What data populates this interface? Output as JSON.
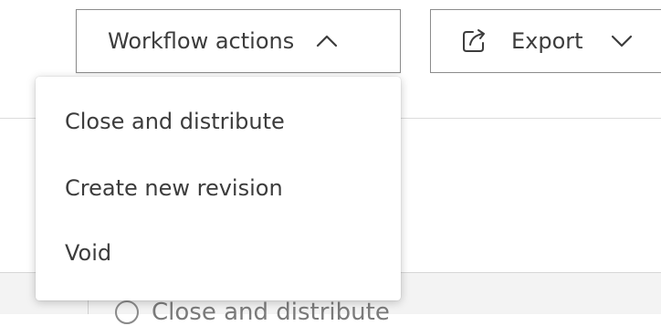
{
  "toolbar": {
    "workflow_label": "Workflow actions",
    "workflow_chevron": "chevron-up-icon",
    "export_label": "Export",
    "export_icon": "export-icon",
    "export_chevron": "chevron-down-icon"
  },
  "menu": {
    "items": [
      {
        "label": "Close and distribute"
      },
      {
        "label": "Create new revision"
      },
      {
        "label": "Void"
      }
    ]
  },
  "background": {
    "partial_item_label": "Close and distribute",
    "partial_item_icon": "info-icon"
  },
  "colors": {
    "text": "#3c3c3c",
    "border": "#8c8c8c",
    "divider": "#dcdcdc",
    "band": "#f3f3f3"
  }
}
